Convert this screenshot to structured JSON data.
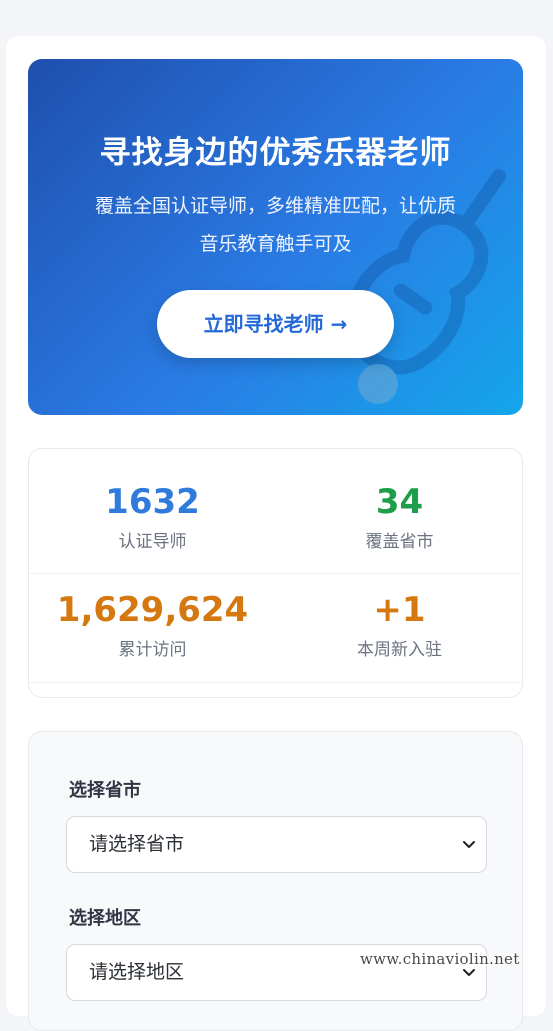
{
  "hero": {
    "title": "寻找身边的优秀乐器老师",
    "subtitle_line1": "覆盖全国认证导师，多维精准匹配，让优质",
    "subtitle_line2": "音乐教育触手可及",
    "cta_label": "立即寻找老师 →",
    "gradient_colors": [
      "#1f4fae",
      "#2a7be4",
      "#14a6ea"
    ]
  },
  "stats": [
    {
      "value": "1632",
      "label": "认证导师",
      "color": "#2f7bdc"
    },
    {
      "value": "34",
      "label": "覆盖省市",
      "color": "#1e9e4a"
    },
    {
      "value": "1,629,624",
      "label": "累计访问",
      "color": "#d4780f"
    },
    {
      "value": "+1",
      "label": "本周新入驻",
      "color": "#d4780f"
    }
  ],
  "filter": {
    "province_label": "选择省市",
    "province_value": "请选择省市",
    "region_label": "选择地区",
    "region_value": "请选择地区"
  },
  "watermark": "www.chinaviolin.net"
}
